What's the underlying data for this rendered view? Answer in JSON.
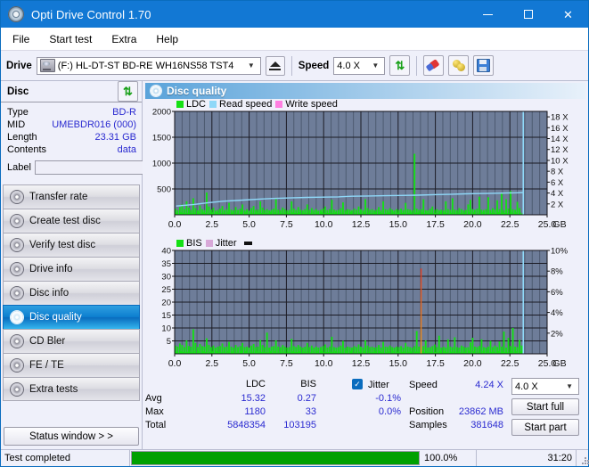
{
  "window": {
    "title": "Opti Drive Control 1.70",
    "icon": "disc-icon",
    "minimize": "minimize-icon",
    "maximize": "maximize-icon",
    "close": "close-icon"
  },
  "menu": {
    "items": [
      "File",
      "Start test",
      "Extra",
      "Help"
    ]
  },
  "toolbar": {
    "drive_label": "Drive",
    "drive_value": "(F:)  HL-DT-ST BD-RE  WH16NS58 TST4",
    "eject_icon": "eject-icon",
    "speed_label": "Speed",
    "speed_value": "4.0 X",
    "refresh_icon": "refresh-icon",
    "erase_icon": "eraser-icon",
    "bulb_icon": "bulb-icon",
    "save_icon": "save-icon"
  },
  "disc": {
    "header": "Disc",
    "refresh_icon": "refresh-icon",
    "rows": [
      {
        "key": "Type",
        "value": "BD-R"
      },
      {
        "key": "MID",
        "value": "UMEBDR016 (000)"
      },
      {
        "key": "Length",
        "value": "23.31 GB"
      },
      {
        "key": "Contents",
        "value": "data"
      }
    ],
    "label_key": "Label",
    "label_value": "",
    "label_placeholder": "",
    "cd_icon": "cd-icon"
  },
  "sidebar": {
    "items": [
      {
        "label": "Transfer rate",
        "icon": "disc-icon",
        "active": false
      },
      {
        "label": "Create test disc",
        "icon": "disc-icon",
        "active": false
      },
      {
        "label": "Verify test disc",
        "icon": "disc-icon",
        "active": false
      },
      {
        "label": "Drive info",
        "icon": "disc-icon",
        "active": false
      },
      {
        "label": "Disc info",
        "icon": "disc-icon",
        "active": false
      },
      {
        "label": "Disc quality",
        "icon": "disc-icon",
        "active": true
      },
      {
        "label": "CD Bler",
        "icon": "disc-icon",
        "active": false
      },
      {
        "label": "FE / TE",
        "icon": "disc-icon",
        "active": false
      },
      {
        "label": "Extra tests",
        "icon": "disc-icon",
        "active": false
      }
    ],
    "status_button": "Status window > >"
  },
  "panel": {
    "title": "Disc quality",
    "icon": "disc-quality-icon"
  },
  "stats": {
    "col_headers": [
      "LDC",
      "BIS"
    ],
    "rows": [
      {
        "label": "Avg",
        "ldc": "15.32",
        "bis": "0.27",
        "jitter": "-0.1%"
      },
      {
        "label": "Max",
        "ldc": "1180",
        "bis": "33",
        "jitter": "0.0%"
      },
      {
        "label": "Total",
        "ldc": "5848354",
        "bis": "103195",
        "jitter": ""
      }
    ],
    "jitter_label": "Jitter",
    "jitter_checked": true,
    "speed_label": "Speed",
    "speed_value": "4.24 X",
    "position_label": "Position",
    "position_value": "23862 MB",
    "samples_label": "Samples",
    "samples_value": "381648",
    "speed_select": "4.0 X",
    "start_full": "Start full",
    "start_part": "Start part"
  },
  "statusbar": {
    "message": "Test completed",
    "progress_text": "100.0%",
    "progress_percent": 100,
    "elapsed": "31:20"
  },
  "colors": {
    "accent": "#1278d4",
    "plot_bg": "#6e7d99",
    "ldc_green": "#14e014",
    "read_speed": "#8fd8f8",
    "write_speed": "#ff7fe0",
    "jitter_pink": "#d8a8d8",
    "value_blue": "#2a2ad0",
    "progress_green": "#00a000"
  },
  "chart_data": [
    {
      "type": "bar",
      "id": "ldc-chart",
      "title": "",
      "legend": [
        {
          "name": "LDC",
          "color": "#14e014"
        },
        {
          "name": "Read speed",
          "color": "#8fd8f8"
        },
        {
          "name": "Write speed",
          "color": "#ff7fe0"
        }
      ],
      "legend_position": "top-left",
      "xlabel": "GB",
      "x_ticks": [
        "0.0",
        "2.5",
        "5.0",
        "7.5",
        "10.0",
        "12.5",
        "15.0",
        "17.5",
        "20.0",
        "22.5",
        "25.0"
      ],
      "xlim": [
        0,
        25
      ],
      "ylabel": "LDC",
      "y_ticks": [
        "500",
        "1000",
        "1500",
        "2000"
      ],
      "ylim": [
        0,
        2000
      ],
      "y2label": "Speed",
      "y2_ticks": [
        "2 X",
        "4 X",
        "6 X",
        "8 X",
        "10 X",
        "12 X",
        "14 X",
        "16 X",
        "18 X"
      ],
      "y2lim": [
        0,
        19
      ],
      "grid": true,
      "end_marker_gb": 23.4,
      "series": [
        {
          "name": "LDC",
          "color": "#14e014",
          "axis": "left",
          "x": [
            0.05,
            0.2,
            0.35,
            0.5,
            0.65,
            0.8,
            0.95,
            1.1,
            1.25,
            1.4,
            1.55,
            1.7,
            1.85,
            2.0,
            2.15,
            2.3,
            2.45,
            2.6,
            2.75,
            2.9,
            3.05,
            3.2,
            3.35,
            3.5,
            3.65,
            3.8,
            3.95,
            4.1,
            4.25,
            4.4,
            4.55,
            4.7,
            4.85,
            5.0,
            5.15,
            5.3,
            5.45,
            5.6,
            5.75,
            5.9,
            6.05,
            6.2,
            6.35,
            6.5,
            6.65,
            6.8,
            6.95,
            7.1,
            7.25,
            7.4,
            7.55,
            7.7,
            7.85,
            8.0,
            8.15,
            8.3,
            8.45,
            8.6,
            8.75,
            8.9,
            9.05,
            9.2,
            9.35,
            9.5,
            9.65,
            9.8,
            9.95,
            10.1,
            10.25,
            10.4,
            10.55,
            10.7,
            10.85,
            11.0,
            11.15,
            11.3,
            11.45,
            11.6,
            11.75,
            11.9,
            12.05,
            12.2,
            12.35,
            12.5,
            12.65,
            12.8,
            12.95,
            13.1,
            13.25,
            13.4,
            13.55,
            13.7,
            13.85,
            14.0,
            14.15,
            14.3,
            14.45,
            14.6,
            14.75,
            14.9,
            15.05,
            15.2,
            15.35,
            15.5,
            15.65,
            15.8,
            15.95,
            16.1,
            16.25,
            16.4,
            16.55,
            16.7,
            16.85,
            17.0,
            17.15,
            17.3,
            17.45,
            17.6,
            17.75,
            17.9,
            18.05,
            18.2,
            18.35,
            18.5,
            18.65,
            18.8,
            18.95,
            19.1,
            19.25,
            19.4,
            19.55,
            19.7,
            19.85,
            20.0,
            20.15,
            20.3,
            20.45,
            20.6,
            20.75,
            20.9,
            21.05,
            21.2,
            21.35,
            21.5,
            21.65,
            21.8,
            21.95,
            22.1,
            22.25,
            22.4,
            22.55,
            22.7,
            22.85,
            23.0,
            23.15,
            23.3
          ],
          "values": [
            120,
            90,
            150,
            200,
            110,
            260,
            140,
            95,
            320,
            130,
            85,
            180,
            110,
            90,
            430,
            160,
            100,
            140,
            80,
            95,
            120,
            170,
            90,
            110,
            230,
            100,
            85,
            150,
            95,
            120,
            200,
            90,
            110,
            80,
            130,
            170,
            95,
            100,
            260,
            140,
            90,
            110,
            85,
            95,
            120,
            300,
            100,
            90,
            140,
            110,
            85,
            95,
            260,
            120,
            90,
            150,
            100,
            85,
            110,
            200,
            95,
            130,
            90,
            110,
            80,
            95,
            120,
            160,
            90,
            110,
            290,
            100,
            85,
            95,
            130,
            240,
            90,
            110,
            100,
            85,
            120,
            95,
            160,
            110,
            90,
            300,
            130,
            95,
            110,
            85,
            100,
            150,
            90,
            260,
            110,
            95,
            130,
            100,
            85,
            110,
            95,
            120,
            90,
            230,
            110,
            100,
            85,
            1180,
            120,
            95,
            110,
            300,
            90,
            85,
            120,
            160,
            95,
            110,
            90,
            100,
            85,
            260,
            110,
            95,
            320,
            100,
            90,
            130,
            110,
            85,
            95,
            200,
            290,
            110,
            95,
            120,
            350,
            100,
            90,
            110,
            340,
            95,
            130,
            100,
            280,
            110,
            420,
            90,
            300,
            120,
            460,
            110,
            95,
            250,
            130
          ]
        },
        {
          "name": "Read speed",
          "color": "#8fd8f8",
          "axis": "right",
          "x": [
            0.1,
            1.3,
            2.2,
            3.3,
            4.6,
            5.8,
            6.6,
            7.7,
            8.9,
            10.0,
            11.0,
            11.9,
            13.0,
            14.1,
            15.2,
            16.3,
            17.4,
            18.4,
            19.5,
            20.4,
            21.3,
            22.2,
            23.0,
            23.4
          ],
          "values": [
            1.6,
            1.9,
            2.2,
            2.5,
            2.7,
            2.9,
            3.0,
            3.1,
            3.2,
            3.25,
            3.3,
            3.4,
            3.45,
            3.5,
            3.55,
            3.6,
            3.7,
            3.75,
            3.85,
            3.9,
            3.95,
            4.0,
            4.05,
            4.1
          ]
        }
      ]
    },
    {
      "type": "bar",
      "id": "bis-chart",
      "title": "",
      "legend": [
        {
          "name": "BIS",
          "color": "#14e014"
        },
        {
          "name": "Jitter",
          "color": "#d8a8d8"
        }
      ],
      "legend_position": "top-left",
      "xlabel": "GB",
      "x_ticks": [
        "0.0",
        "2.5",
        "5.0",
        "7.5",
        "10.0",
        "12.5",
        "15.0",
        "17.5",
        "20.0",
        "22.5",
        "25.0"
      ],
      "xlim": [
        0,
        25
      ],
      "ylabel": "BIS",
      "y_ticks": [
        "5",
        "10",
        "15",
        "20",
        "25",
        "30",
        "35",
        "40"
      ],
      "ylim": [
        0,
        40
      ],
      "y2label": "Jitter",
      "y2_ticks": [
        "2%",
        "4%",
        "6%",
        "8%",
        "10%"
      ],
      "y2lim": [
        0,
        10
      ],
      "grid": true,
      "end_marker_gb": 23.4,
      "series": [
        {
          "name": "BIS",
          "color": "#14e014",
          "axis": "left",
          "x": [
            0.05,
            0.2,
            0.35,
            0.5,
            0.65,
            0.8,
            0.95,
            1.1,
            1.25,
            1.4,
            1.55,
            1.7,
            1.85,
            2.0,
            2.15,
            2.3,
            2.45,
            2.6,
            2.75,
            2.9,
            3.05,
            3.2,
            3.35,
            3.5,
            3.65,
            3.8,
            3.95,
            4.1,
            4.25,
            4.4,
            4.55,
            4.7,
            4.85,
            5.0,
            5.15,
            5.3,
            5.45,
            5.6,
            5.75,
            5.9,
            6.05,
            6.2,
            6.35,
            6.5,
            6.65,
            6.8,
            6.95,
            7.1,
            7.25,
            7.4,
            7.55,
            7.7,
            7.85,
            8.0,
            8.15,
            8.3,
            8.45,
            8.6,
            8.75,
            8.9,
            9.05,
            9.2,
            9.35,
            9.5,
            9.65,
            9.8,
            9.95,
            10.1,
            10.25,
            10.4,
            10.55,
            10.7,
            10.85,
            11.0,
            11.15,
            11.3,
            11.45,
            11.6,
            11.75,
            11.9,
            12.05,
            12.2,
            12.35,
            12.5,
            12.65,
            12.8,
            12.95,
            13.1,
            13.25,
            13.4,
            13.55,
            13.7,
            13.85,
            14.0,
            14.15,
            14.3,
            14.45,
            14.6,
            14.75,
            14.9,
            15.05,
            15.2,
            15.35,
            15.5,
            15.65,
            15.8,
            15.95,
            16.1,
            16.25,
            16.4,
            16.55,
            16.7,
            16.85,
            17.0,
            17.15,
            17.3,
            17.45,
            17.6,
            17.75,
            17.9,
            18.05,
            18.2,
            18.35,
            18.5,
            18.65,
            18.8,
            18.95,
            19.1,
            19.25,
            19.4,
            19.55,
            19.7,
            19.85,
            20.0,
            20.15,
            20.3,
            20.45,
            20.6,
            20.75,
            20.9,
            21.05,
            21.2,
            21.35,
            21.5,
            21.65,
            21.8,
            21.95,
            22.1,
            22.25,
            22.4,
            22.55,
            22.7,
            22.85,
            23.0,
            23.15,
            23.3
          ],
          "values": [
            3.2,
            2.8,
            4.0,
            3.4,
            2.6,
            5.2,
            3.0,
            2.8,
            9.5,
            4.2,
            2.6,
            3.8,
            3.0,
            2.8,
            6.0,
            3.4,
            2.6,
            3.2,
            2.4,
            2.8,
            3.0,
            4.0,
            2.6,
            2.8,
            4.6,
            2.8,
            2.4,
            3.4,
            2.6,
            3.0,
            4.2,
            2.6,
            2.8,
            2.4,
            3.2,
            3.8,
            2.6,
            2.8,
            5.4,
            3.4,
            2.6,
            8.2,
            2.4,
            2.8,
            3.0,
            5.2,
            2.8,
            2.6,
            3.4,
            2.8,
            2.4,
            2.6,
            5.8,
            3.0,
            2.6,
            3.4,
            2.8,
            2.4,
            2.8,
            4.2,
            2.6,
            3.2,
            2.4,
            2.8,
            2.4,
            2.6,
            3.0,
            3.6,
            2.4,
            2.8,
            6.6,
            2.6,
            2.4,
            2.6,
            3.2,
            5.0,
            2.4,
            2.8,
            2.6,
            2.4,
            3.0,
            2.6,
            3.6,
            2.8,
            2.4,
            5.2,
            3.2,
            2.6,
            2.8,
            2.4,
            2.6,
            3.4,
            2.4,
            4.6,
            2.8,
            2.6,
            3.2,
            2.6,
            2.4,
            2.8,
            2.6,
            3.0,
            2.4,
            4.2,
            2.8,
            2.6,
            2.4,
            3.0,
            8.8,
            2.8,
            2.6,
            3.0,
            5.2,
            2.4,
            2.6,
            3.0,
            3.6,
            2.6,
            7.0,
            2.4,
            2.8,
            2.4,
            5.6,
            2.8,
            2.6,
            6.4,
            2.6,
            2.4,
            3.2,
            2.8,
            2.4,
            2.6,
            4.4,
            6.2,
            2.8,
            2.6,
            3.0,
            5.6,
            2.6,
            2.4,
            2.8,
            5.0,
            2.6,
            3.2,
            2.6,
            4.8,
            2.8,
            8.6,
            2.4,
            6.2,
            3.0,
            10.0,
            2.8,
            2.6,
            5.4,
            3.2
          ]
        },
        {
          "name": "Jitter",
          "color": "#d8a8d8",
          "axis": "right",
          "x": [
            16.5
          ],
          "values": [
            8.25
          ]
        }
      ]
    }
  ]
}
